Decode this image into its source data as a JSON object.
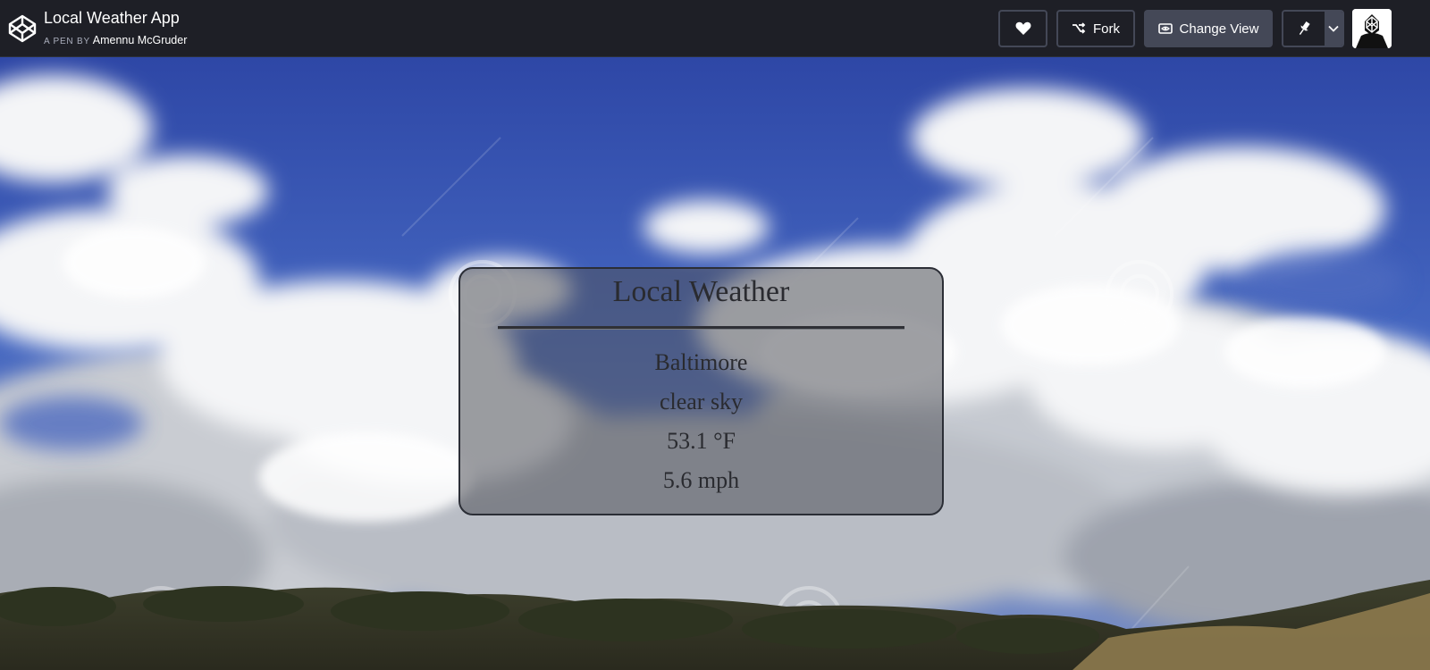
{
  "header": {
    "pen_title": "Local Weather App",
    "by_label": "A PEN BY",
    "author": "Amennu McGruder",
    "fork_label": "Fork",
    "change_view_label": "Change View"
  },
  "icons": {
    "logo": "codepen-logo-icon",
    "heart": "heart-icon",
    "fork": "fork-icon",
    "view": "eye-icon",
    "pin": "pin-icon",
    "caret": "chevron-down-icon"
  },
  "weather": {
    "title": "Local Weather",
    "city": "Baltimore",
    "description": "clear sky",
    "temperature": "53.1 °F",
    "wind": "5.6 mph"
  },
  "colors": {
    "topbar": "#1e1f26",
    "button_border": "#444857",
    "sky_blue": "#3b55ad"
  }
}
